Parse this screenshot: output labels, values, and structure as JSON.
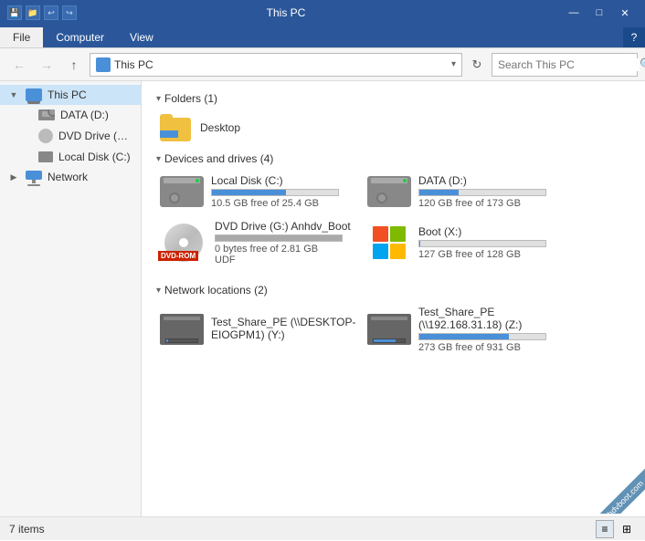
{
  "titlebar": {
    "title": "This PC",
    "icons": [
      "save",
      "folder",
      "undo",
      "redo"
    ],
    "min": "—",
    "max": "□",
    "close": "✕"
  },
  "ribbon": {
    "tabs": [
      "File",
      "Computer",
      "View"
    ],
    "active": "Computer",
    "help": "?"
  },
  "toolbar": {
    "back": "←",
    "forward": "→",
    "up": "↑",
    "address": "This PC",
    "refresh": "↻",
    "search_placeholder": "Search This PC"
  },
  "sidebar": {
    "items": [
      {
        "id": "this-pc",
        "label": "This PC",
        "expand": "▼",
        "active": true
      },
      {
        "id": "data-d",
        "label": "DATA (D:)",
        "expand": ""
      },
      {
        "id": "dvd-g",
        "label": "DVD Drive (G:) Anhd",
        "expand": ""
      },
      {
        "id": "local-c",
        "label": "Local Disk (C:)",
        "expand": ""
      },
      {
        "id": "network",
        "label": "Network",
        "expand": "▶"
      }
    ]
  },
  "content": {
    "folders_header": "Folders (1)",
    "folders": [
      {
        "name": "Desktop"
      }
    ],
    "drives_header": "Devices and drives (4)",
    "drives": [
      {
        "id": "local-c",
        "name": "Local Disk (C:)",
        "free": "10.5 GB free of 25.4 GB",
        "fill_pct": 59,
        "color": "#4a90d9",
        "type": "hdd"
      },
      {
        "id": "data-d",
        "name": "DATA (D:)",
        "free": "120 GB free of 173 GB",
        "fill_pct": 31,
        "color": "#4a90d9",
        "type": "hdd"
      },
      {
        "id": "dvd-g",
        "name": "DVD Drive (G:) Anhdv_Boot",
        "free": "0 bytes free of 2.81 GB",
        "fill_pct": 100,
        "color": "#aaa",
        "type": "dvd",
        "label": "DVD-ROM",
        "fs": "UDF"
      },
      {
        "id": "boot-x",
        "name": "Boot (X:)",
        "free": "127 GB free of 128 GB",
        "fill_pct": 1,
        "color": "#4a90d9",
        "type": "windows"
      }
    ],
    "network_header": "Network locations (2)",
    "network_drives": [
      {
        "id": "net-y",
        "name": "Test_Share_PE (\\\\DESKTOP-EIOGPM1) (Y:)",
        "free": "",
        "fill_pct": 5,
        "color": "#4a90d9",
        "type": "net"
      },
      {
        "id": "net-z",
        "name": "Test_Share_PE (\\\\192.168.31.18) (Z:)",
        "free": "273 GB free of 931 GB",
        "fill_pct": 71,
        "color": "#4a90d9",
        "type": "net"
      }
    ]
  },
  "statusbar": {
    "count": "7 items"
  },
  "watermark": "anhdvboot.com"
}
